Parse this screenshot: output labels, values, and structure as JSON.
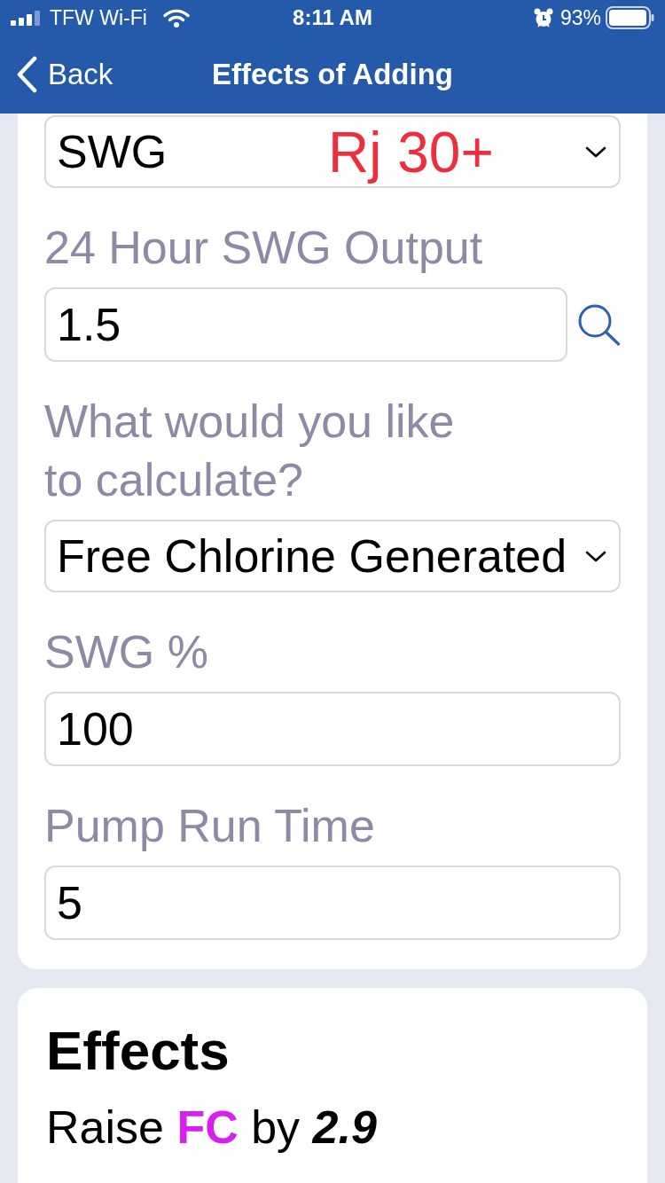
{
  "status_bar": {
    "carrier": "TFW Wi-Fi",
    "time": "8:11 AM",
    "battery": "93%"
  },
  "nav_bar": {
    "back": "Back",
    "title": "Effects of Adding"
  },
  "form": {
    "fields": [
      {
        "kind": "select",
        "value": "SWG",
        "annotation": "Rj 30+"
      },
      {
        "kind": "input",
        "label": "24 Hour SWG Output",
        "value": "1.5",
        "lookup": true
      },
      {
        "kind": "select",
        "label": "What would you like to calculate?",
        "value": "Free Chlorine Generated"
      },
      {
        "kind": "input",
        "label": "SWG %",
        "value": "100",
        "lookup": false
      },
      {
        "kind": "input",
        "label": "Pump Run Time",
        "value": "5",
        "lookup": false
      }
    ]
  },
  "effects": {
    "title": "Effects",
    "results": [
      {
        "parts": [
          {
            "kind": "text",
            "text": "Raise"
          },
          {
            "kind": "chemical",
            "text": "FC",
            "color": "#d81ff0"
          },
          {
            "kind": "text",
            "text": "by"
          },
          {
            "kind": "amount",
            "text": "2.9"
          }
        ]
      }
    ]
  }
}
